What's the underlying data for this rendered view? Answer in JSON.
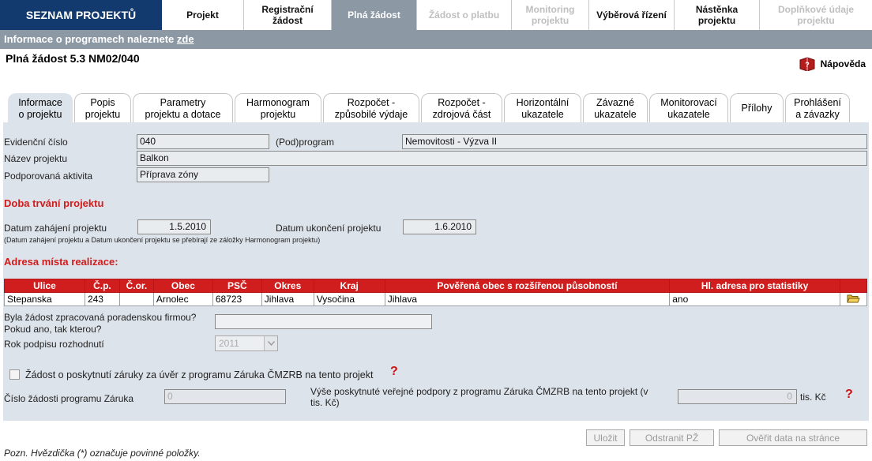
{
  "nav": {
    "brand": "SEZNAM PROJEKTŮ",
    "items": [
      {
        "label": "Projekt"
      },
      {
        "label": "Registrační\nžádost"
      },
      {
        "label": "Plná žádost"
      },
      {
        "label": "Žádost o platbu"
      },
      {
        "label": "Monitoring\nprojektu"
      },
      {
        "label": "Výběrová řízení"
      },
      {
        "label": "Nástěnka\nprojektu"
      },
      {
        "label": "Doplňkové údaje\nprojektu"
      }
    ]
  },
  "infobar": {
    "text": "Informace o programech naleznete ",
    "link": "zde"
  },
  "page": {
    "title": "Plná žádost  5.3 NM02/040",
    "help": "Nápověda"
  },
  "tabs": [
    {
      "label": "Informace\no projektu"
    },
    {
      "label": "Popis\nprojektu"
    },
    {
      "label": "Parametry\nprojektu a dotace"
    },
    {
      "label": "Harmonogram\nprojektu"
    },
    {
      "label": "Rozpočet -\nzpůsobilé výdaje"
    },
    {
      "label": "Rozpočet -\nzdrojová část"
    },
    {
      "label": "Horizontální\nukazatele"
    },
    {
      "label": "Závazné\nukazatele"
    },
    {
      "label": "Monitorovací\nukazatele"
    },
    {
      "label": "Přílohy"
    },
    {
      "label": "Prohlášení\na závazky"
    }
  ],
  "form": {
    "evidencni_label": "Evidenční číslo",
    "evidencni_value": "040",
    "podprogram_label": "(Pod)program",
    "podprogram_value": "Nemovitosti - Výzva II",
    "nazev_label": "Název projektu",
    "nazev_value": "Balkon",
    "aktivita_label": "Podporovaná aktivita",
    "aktivita_value": "Příprava zóny",
    "doba_heading": "Doba trvání projektu",
    "zahajeni_label": "Datum zahájení projektu",
    "zahajeni_value": "1.5.2010",
    "ukonceni_label": "Datum ukončení projektu",
    "ukonceni_value": "1.6.2010",
    "doba_note": "(Datum zahájení projektu a Datum ukončení projektu se přebírají ze záložky Harmonogram projektu)",
    "adresa_heading": "Adresa místa realizace:",
    "poradenska_label": "Byla žádost zpracovaná poradenskou firmou?\nPokud ano, tak kterou?",
    "rok_label": "Rok podpisu rozhodnutí",
    "rok_value": "2011",
    "zaruka_check_label": "Žádost o poskytnutí záruky za úvěr z programu Záruka ČMZRB na tento projekt",
    "cislo_zaruka_label": "Číslo žádosti programu Záruka",
    "cislo_zaruka_value": "0",
    "vyse_label": "Výše poskytnuté veřejné podpory z programu Záruka ČMZRB na tento projekt (v\ntis. Kč)",
    "vyse_value": "0",
    "vyse_unit": "tis. Kč",
    "help_mark": "?"
  },
  "address_table": {
    "headers": [
      "Ulice",
      "Č.p.",
      "Č.or.",
      "Obec",
      "PSČ",
      "Okres",
      "Kraj",
      "Pověřená obec s rozšířenou působností",
      "Hl. adresa pro statistiky",
      ""
    ],
    "rows": [
      [
        "Stepanska",
        "243",
        "",
        "Arnolec",
        "68723",
        "Jihlava",
        "Vysočina",
        "Jihlava",
        "ano"
      ]
    ]
  },
  "buttons": {
    "save": "Uložit",
    "remove": "Odstranit PŽ",
    "verify": "Ověřit data na stránce"
  },
  "footer": {
    "note": "Pozn. Hvězdička (*) označuje povinné položky."
  }
}
